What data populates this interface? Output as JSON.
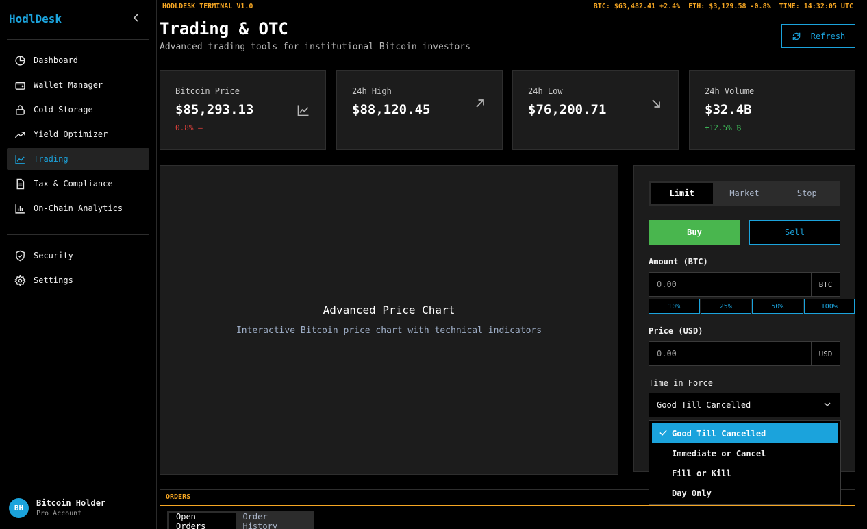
{
  "app": {
    "brand": "HodlDesk"
  },
  "sidebar": {
    "items": [
      {
        "label": "Dashboard",
        "icon": "pie-chart-icon"
      },
      {
        "label": "Wallet Manager",
        "icon": "wallet-icon"
      },
      {
        "label": "Cold Storage",
        "icon": "lock-icon"
      },
      {
        "label": "Yield Optimizer",
        "icon": "trending-up-icon"
      },
      {
        "label": "Trading",
        "icon": "line-chart-icon",
        "active": true
      },
      {
        "label": "Tax & Compliance",
        "icon": "document-icon"
      },
      {
        "label": "On-Chain Analytics",
        "icon": "bar-chart-icon"
      }
    ],
    "bottom_items": [
      {
        "label": "Security",
        "icon": "shield-icon"
      },
      {
        "label": "Settings",
        "icon": "gear-icon"
      }
    ],
    "user": {
      "initials": "BH",
      "name": "Bitcoin Holder",
      "role": "Pro Account"
    }
  },
  "ticker": {
    "title": "HODLDESK TERMINAL V1.0",
    "btc": "BTC: $63,482.41 +2.4%",
    "eth": "ETH: $3,129.58 -0.8%",
    "time": "TIME: 14:32:05 UTC"
  },
  "header": {
    "title": "Trading & OTC",
    "subtitle": "Advanced trading tools for institutional Bitcoin investors",
    "refresh_label": "Refresh"
  },
  "stats": [
    {
      "label": "Bitcoin Price",
      "value": "$85,293.13",
      "change": "0.8% —",
      "change_type": "negative",
      "icon": "line-chart-icon"
    },
    {
      "label": "24h High",
      "value": "$88,120.45",
      "change": "",
      "icon": "arrow-up-right-icon"
    },
    {
      "label": "24h Low",
      "value": "$76,200.71",
      "change": "",
      "icon": "arrow-down-right-icon"
    },
    {
      "label": "24h Volume",
      "value": "$32.4B",
      "change": "+12.5% ₿",
      "change_type": "positive"
    }
  ],
  "chart": {
    "title": "Advanced Price Chart",
    "subtitle": "Interactive Bitcoin price chart with technical indicators"
  },
  "order": {
    "tabs": [
      "Limit",
      "Market",
      "Stop"
    ],
    "active_tab": "Limit",
    "buy_label": "Buy",
    "sell_label": "Sell",
    "amount_label": "Amount (BTC)",
    "amount_placeholder": "0.00",
    "amount_unit": "BTC",
    "percent_buttons": [
      "10%",
      "25%",
      "50%",
      "100%"
    ],
    "price_label": "Price (USD)",
    "price_placeholder": "0.00",
    "price_unit": "USD",
    "tif_label": "Time in Force",
    "tif_selected": "Good Till Cancelled",
    "tif_options": [
      "Good Till Cancelled",
      "Immediate or Cancel",
      "Fill or Kill",
      "Day Only"
    ]
  },
  "orders": {
    "heading": "ORDERS",
    "tabs": [
      "Open Orders",
      "Order History"
    ]
  },
  "colors": {
    "accent": "#1ba3dc",
    "buy": "#49b64e",
    "ticker": "#f5a623",
    "negative": "#e0413b",
    "positive": "#3fbf5b"
  }
}
